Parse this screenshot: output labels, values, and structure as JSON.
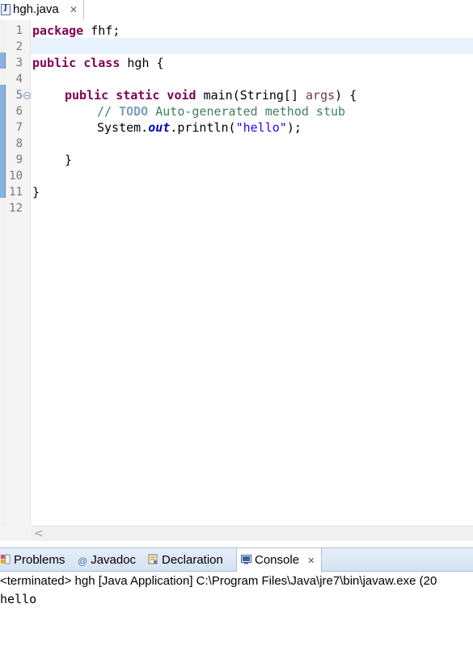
{
  "editor": {
    "tab": {
      "filename": "hgh.java",
      "icon_letter": "J",
      "close_glyph": "✕"
    },
    "lines": [
      {
        "num": "1"
      },
      {
        "num": "2"
      },
      {
        "num": "3"
      },
      {
        "num": "4"
      },
      {
        "num": "5",
        "fold": "−"
      },
      {
        "num": "6"
      },
      {
        "num": "7"
      },
      {
        "num": "8"
      },
      {
        "num": "9"
      },
      {
        "num": "10"
      },
      {
        "num": "11"
      },
      {
        "num": "12"
      }
    ],
    "code": {
      "l1_kw": "package",
      "l1_rest": " fhf;",
      "l3_kw": "public class",
      "l3_rest": " hgh {",
      "l5_kw": "public static void",
      "l5_mid": " main(String[] ",
      "l5_param": "args",
      "l5_end": ") {",
      "l6_cmt": "// ",
      "l6_todo": "TODO",
      "l6_rest": " Auto-generated method stub",
      "l7_pre": "System.",
      "l7_field": "out",
      "l7_mid": ".println(",
      "l7_str": "\"hello\"",
      "l7_end": ");",
      "l9": "}",
      "l11": "}"
    },
    "scroll_arrow": "<"
  },
  "panel": {
    "tabs": {
      "problems": "Problems",
      "javadoc": "Javadoc",
      "javadoc_icon": "@",
      "declaration": "Declaration",
      "console": "Console",
      "console_close": "✕"
    },
    "console_header": "<terminated> hgh [Java Application] C:\\Program Files\\Java\\jre7\\bin\\javaw.exe (20",
    "console_output": "hello"
  },
  "colors": {
    "keyword": "#7f0055",
    "comment": "#3f7f5f",
    "todo": "#7f9fbf",
    "field": "#0000c0",
    "string": "#2a00ff",
    "current_line": "#e8f2fe",
    "change_marker": "#8ab3d9"
  }
}
